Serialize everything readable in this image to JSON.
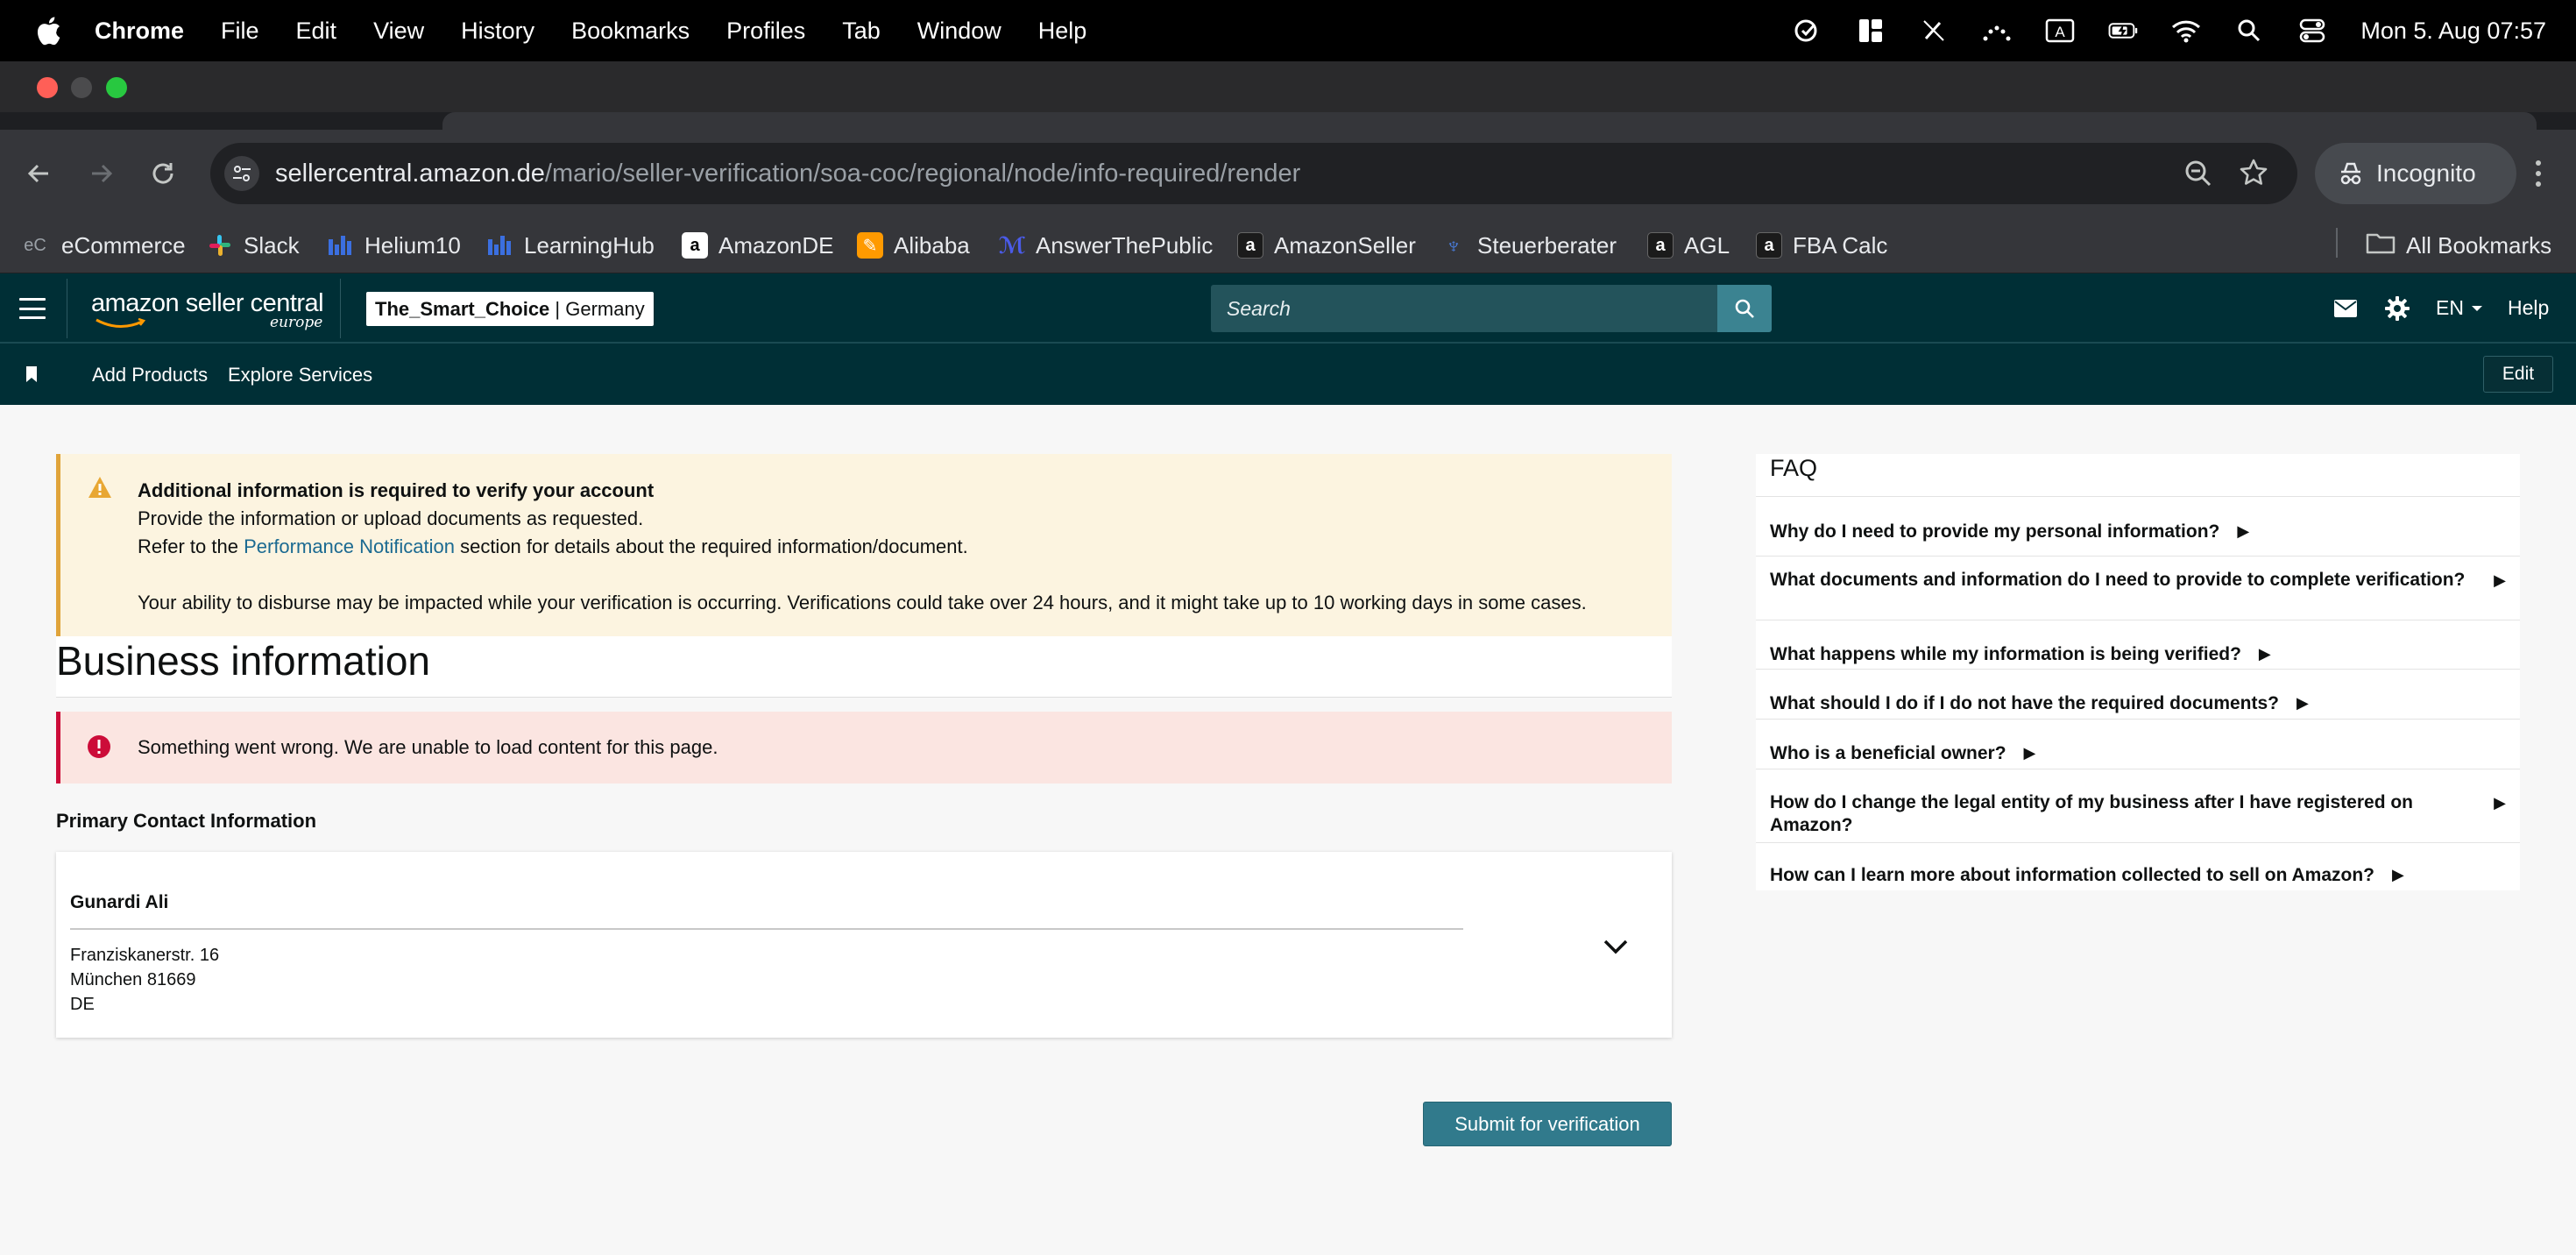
{
  "menubar": {
    "app": "Chrome",
    "items": [
      "File",
      "Edit",
      "View",
      "History",
      "Bookmarks",
      "Profiles",
      "Tab",
      "Window",
      "Help"
    ],
    "clock": "Mon 5. Aug  07:57"
  },
  "browser": {
    "url_host": "sellercentral.amazon.de",
    "url_path": "/mario/seller-verification/soa-coc/regional/node/info-required/render",
    "profile_label": "Incognito",
    "bookmarks": [
      "eCommerce",
      "Slack",
      "Helium10",
      "LearningHub",
      "AmazonDE",
      "Alibaba",
      "AnswerThePublic",
      "AmazonSeller",
      "Steuerberater",
      "AGL",
      "FBA Calc"
    ],
    "all_bookmarks": "All Bookmarks"
  },
  "seller_central": {
    "logo_main": "amazon seller central",
    "logo_sub": "europe",
    "account_name": "The_Smart_Choice",
    "account_region": " | Germany",
    "search_placeholder": "Search",
    "language": "EN",
    "help": "Help",
    "subnav": [
      "Add Products",
      "Explore Services"
    ],
    "edit": "Edit"
  },
  "warning": {
    "title": "Additional information is required to verify your account",
    "line1": "Provide the information or upload documents as requested.",
    "line2_pre": "Refer to the ",
    "line2_link": "Performance Notification",
    "line2_post": " section for details about the required information/document.",
    "line3": "Your ability to disburse may be impacted while your verification is occurring. Verifications could take over 24 hours, and it might take up to 10 working days in some cases."
  },
  "page": {
    "title": "Business information",
    "error": "Something went wrong. We are unable to load content for this page.",
    "primary_contact_title": "Primary Contact Information",
    "contact": {
      "name": "Gunardi Ali",
      "street": "Franziskanerstr. 16",
      "city": "München 81669",
      "country": "DE"
    },
    "submit": "Submit for verification"
  },
  "faq": {
    "title": "FAQ",
    "items": [
      "Why do I need to provide my personal information?",
      "What documents and information do I need to provide to complete verification?",
      "What happens while my information is being verified?",
      "What should I do if I do not have the required documents?",
      "Who is a beneficial owner?",
      "How do I change the legal entity of my business after I have registered on Amazon?",
      "How can I learn more about information collected to sell on Amazon?"
    ]
  },
  "colors": {
    "header_bg": "#002f36",
    "warning_bg": "#fcf4e0",
    "error_bg": "#fbe5e1",
    "primary_button": "#317a8c",
    "link": "#1b6a91"
  }
}
